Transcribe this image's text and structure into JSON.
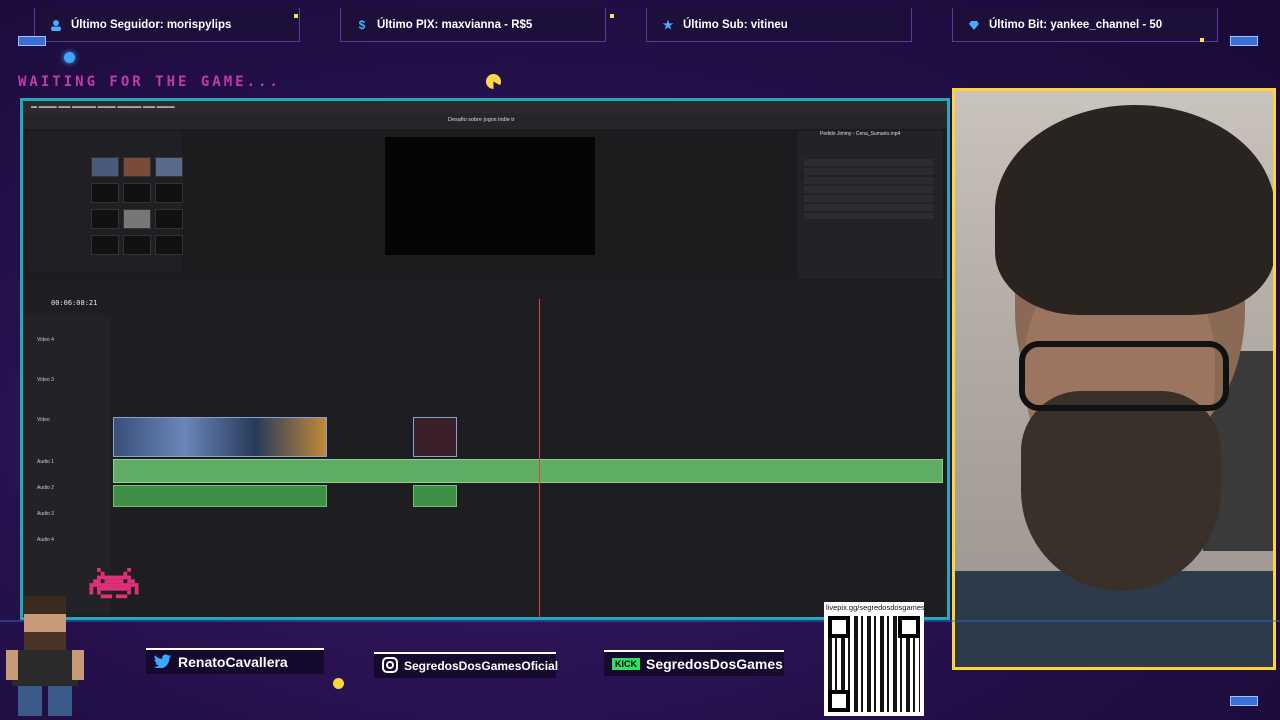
{
  "alerts": [
    {
      "icon": "user-icon",
      "text": "Último Seguidor: morispylips"
    },
    {
      "icon": "dollar-icon",
      "text": "Último PIX: maxvianna - R$5"
    },
    {
      "icon": "star-icon",
      "text": "Último Sub: vitineu"
    },
    {
      "icon": "diamond-icon",
      "text": "Último Bit: yankee_channel - 50"
    }
  ],
  "waiting_text": "WAITING FOR THE GAME...",
  "editor": {
    "project_title": "Desafio sobre jogos indie tr",
    "timecode": "00:06:08:21",
    "inspector_title": "Pedido Jimmy - Cena_Sumario.mp4",
    "tracks": [
      "Video 4",
      "Video 3",
      "Video",
      "Audio 1",
      "Audio 2",
      "Audio 3",
      "Audio 4"
    ]
  },
  "socials": {
    "twitter": "RenatoCavallera",
    "instagram": "SegredosDosGamesOficial",
    "kick_badge": "KICK",
    "kick": "SegredosDosGames"
  },
  "qr": {
    "label": "livepix.gg/segredosdosgames"
  }
}
